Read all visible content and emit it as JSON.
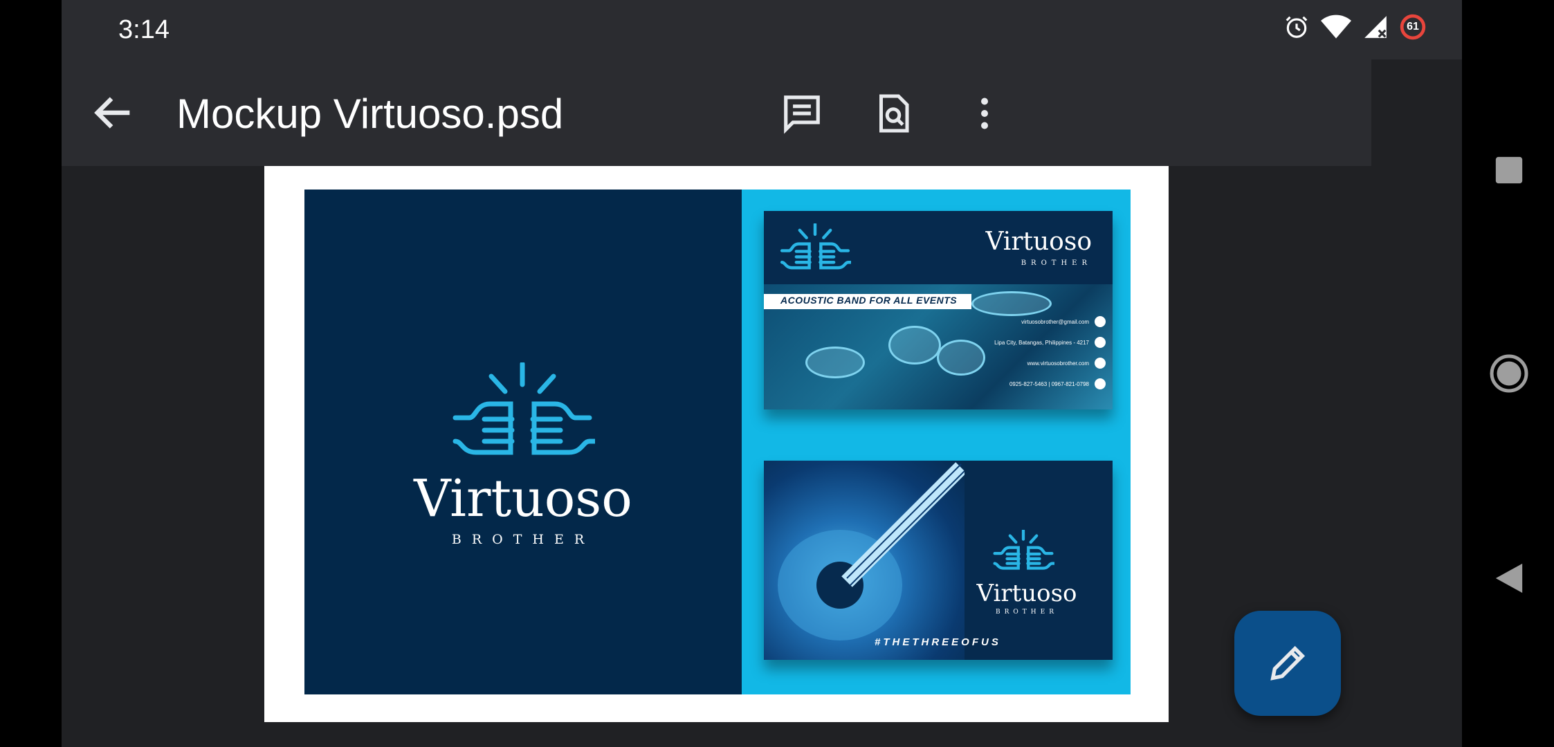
{
  "status_bar": {
    "time": "3:14",
    "battery_level": "61",
    "icons": [
      "alarm-icon",
      "wifi-icon",
      "cell-signal-icon",
      "battery-icon"
    ]
  },
  "toolbar": {
    "title": "Mockup Virtuoso.psd",
    "back_icon": "arrow-left-icon",
    "comment_icon": "comment-icon",
    "find_icon": "find-in-page-icon",
    "more_icon": "more-vert-icon"
  },
  "document": {
    "main_brand": "Virtuoso",
    "main_brand_sub": "BROTHER",
    "card1": {
      "brand": "Virtuoso",
      "brand_sub": "BROTHER",
      "tagline": "ACOUSTIC BAND FOR ALL EVENTS",
      "email": "virtuosobrother@gmail.com",
      "address": "Lipa City, Batangas, Philippines - 4217",
      "website": "www.virtuosobrother.com",
      "phone": "0925-827-5463 | 0967-821-0798"
    },
    "card2": {
      "brand": "Virtuoso",
      "brand_sub": "BROTHER",
      "hashtag": "#THETHREEOFUS"
    },
    "colors": {
      "navy": "#03284a",
      "cyan": "#12b8e6"
    }
  },
  "fab": {
    "icon": "edit-pencil-icon",
    "color": "#0b4f8a"
  },
  "nav": {
    "items": [
      "recents-square-icon",
      "home-circle-icon",
      "back-triangle-icon"
    ]
  }
}
